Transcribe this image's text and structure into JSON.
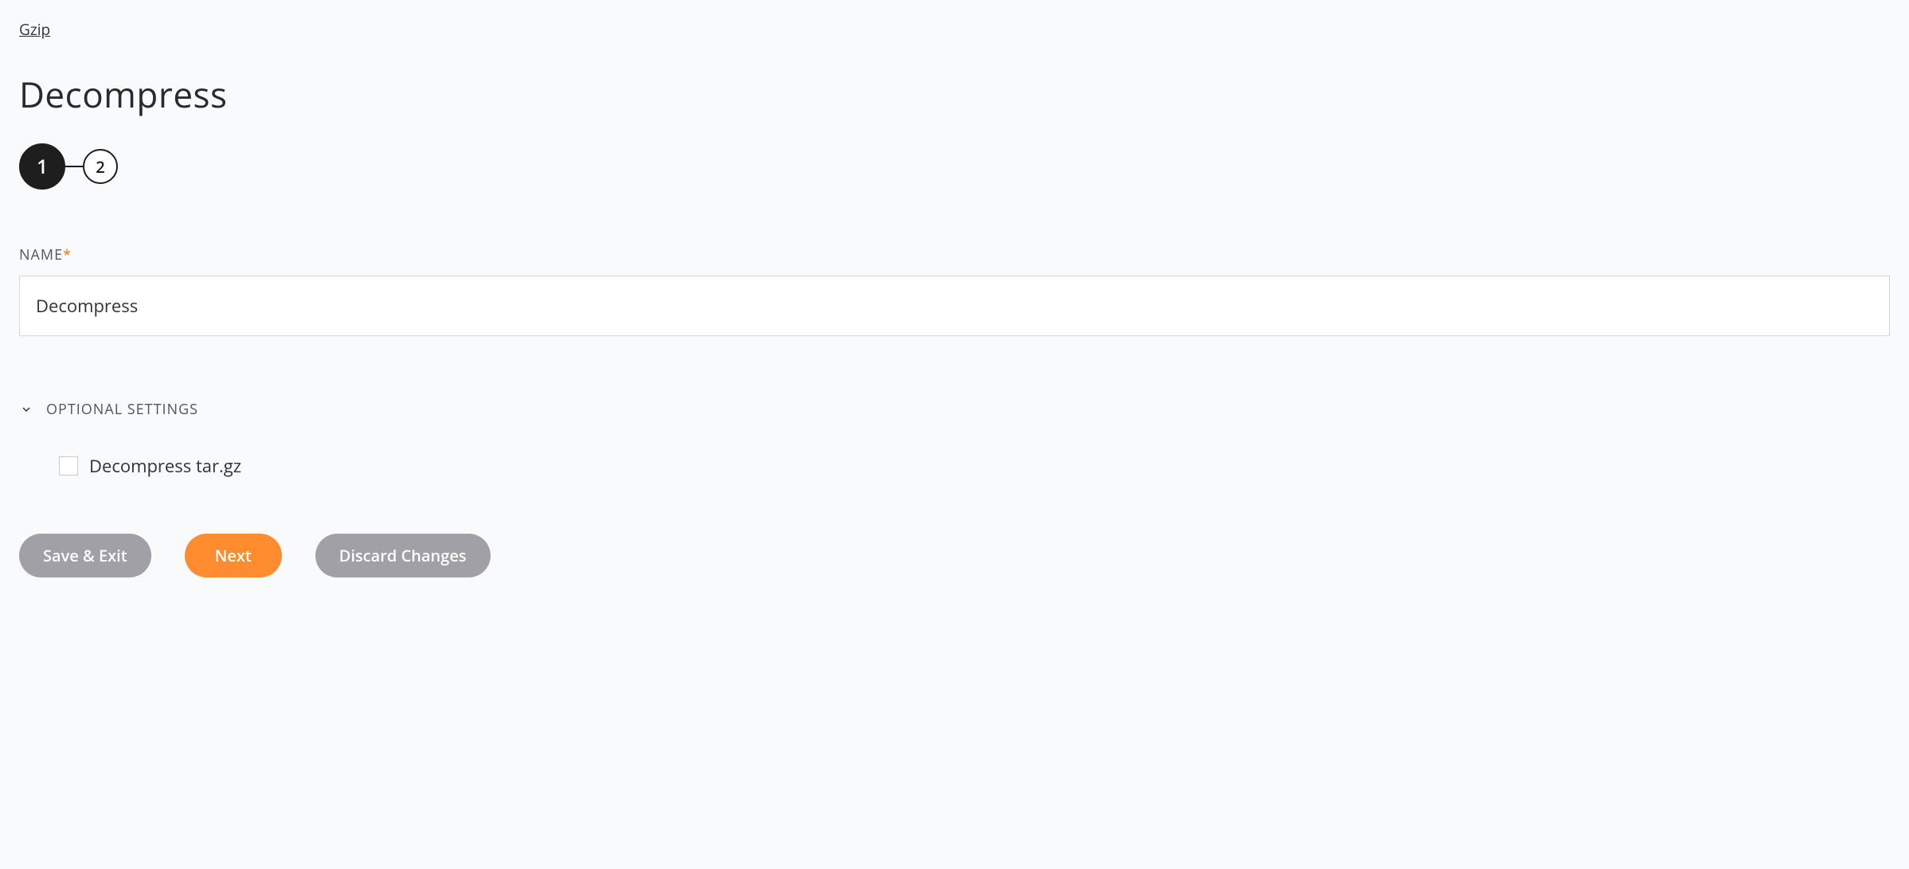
{
  "breadcrumb": "Gzip",
  "title": "Decompress",
  "stepper": {
    "steps": [
      "1",
      "2"
    ],
    "active_index": 0
  },
  "form": {
    "name_label": "NAME",
    "name_value": "Decompress"
  },
  "optional": {
    "header_label": "OPTIONAL SETTINGS",
    "checkbox_label": "Decompress tar.gz",
    "checkbox_checked": false
  },
  "buttons": {
    "save_exit": "Save & Exit",
    "next": "Next",
    "discard": "Discard Changes"
  }
}
